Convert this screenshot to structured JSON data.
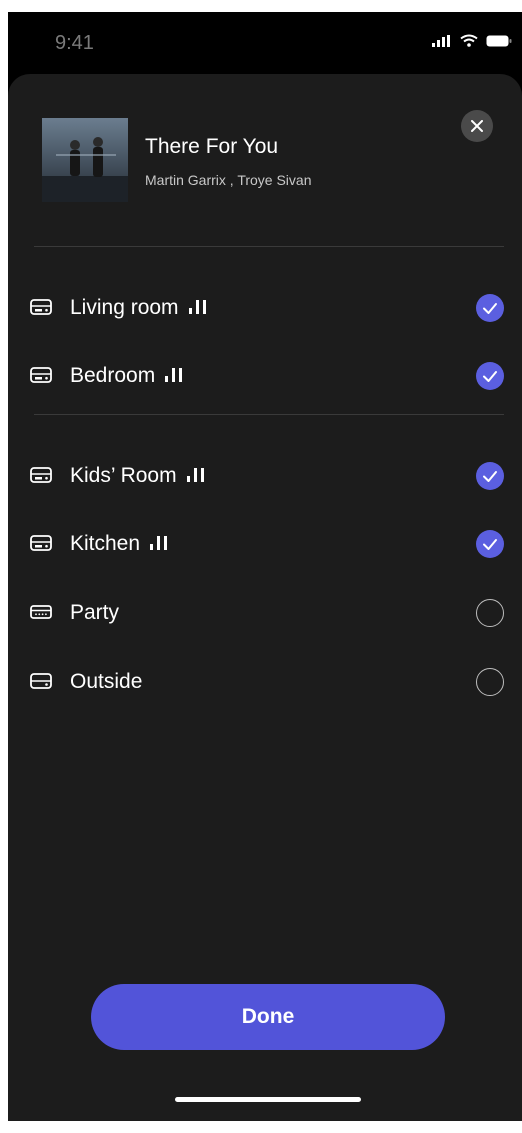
{
  "status": {
    "time": "9:41"
  },
  "now_playing": {
    "title": "There For You",
    "artist": "Martin Garrix , Troye Sivan"
  },
  "rooms_group1": [
    {
      "name": "Living room",
      "playing": true,
      "selected": true
    },
    {
      "name": "Bedroom",
      "playing": true,
      "selected": true
    }
  ],
  "rooms_group2": [
    {
      "name": "Kids’ Room",
      "playing": true,
      "selected": true
    },
    {
      "name": "Kitchen",
      "playing": true,
      "selected": true
    },
    {
      "name": "Party",
      "playing": false,
      "selected": false
    },
    {
      "name": "Outside",
      "playing": false,
      "selected": false
    }
  ],
  "done_label": "Done",
  "colors": {
    "accent": "#5254d9",
    "sheet": "#1c1c1c",
    "check": "#5b5fe0"
  }
}
